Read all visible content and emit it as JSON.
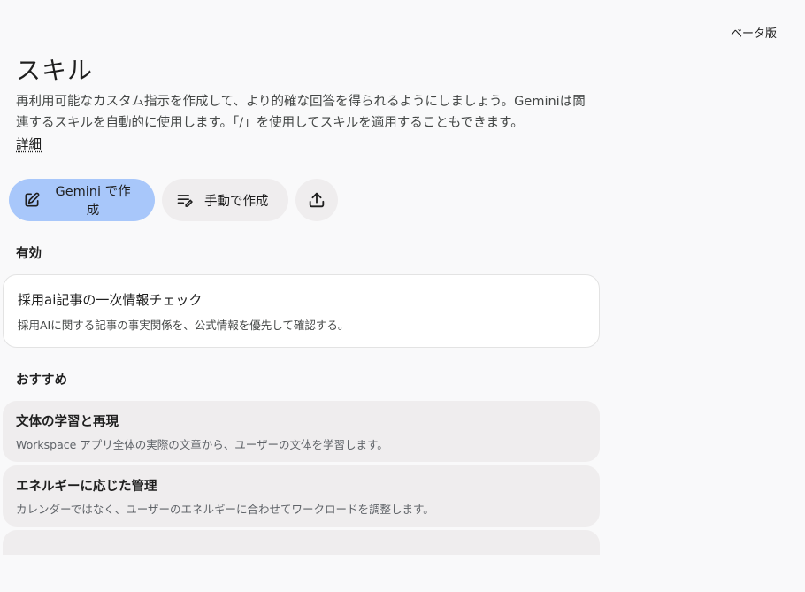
{
  "header": {
    "beta_label": "ベータ版",
    "title": "スキル",
    "description": "再利用可能なカスタム指示を作成して、より的確な回答を得られるようにしましょう。Geminiは関連するスキルを自動的に使用します。「/」を使用してスキルを適用することもできます。",
    "learn_more": "詳細"
  },
  "actions": {
    "create_with_gemini": "Gemini で作成",
    "create_manually": "手動で作成",
    "upload_icon": "upload-icon"
  },
  "active_section": {
    "label": "有効",
    "items": [
      {
        "title": "採用ai記事の一次情報チェック",
        "description": "採用AIに関する記事の事実関係を、公式情報を優先して確認する。"
      }
    ]
  },
  "recommended_section": {
    "label": "おすすめ",
    "items": [
      {
        "title": "文体の学習と再現",
        "description": "Workspace アプリ全体の実際の文章から、ユーザーの文体を学習します。"
      },
      {
        "title": "エネルギーに応じた管理",
        "description": "カレンダーではなく、ユーザーのエネルギーに合わせてワークロードを調整します。"
      }
    ]
  },
  "colors": {
    "primary_button": "#a8c7fa",
    "secondary_button": "#efedee",
    "background": "#f9f9fa"
  }
}
